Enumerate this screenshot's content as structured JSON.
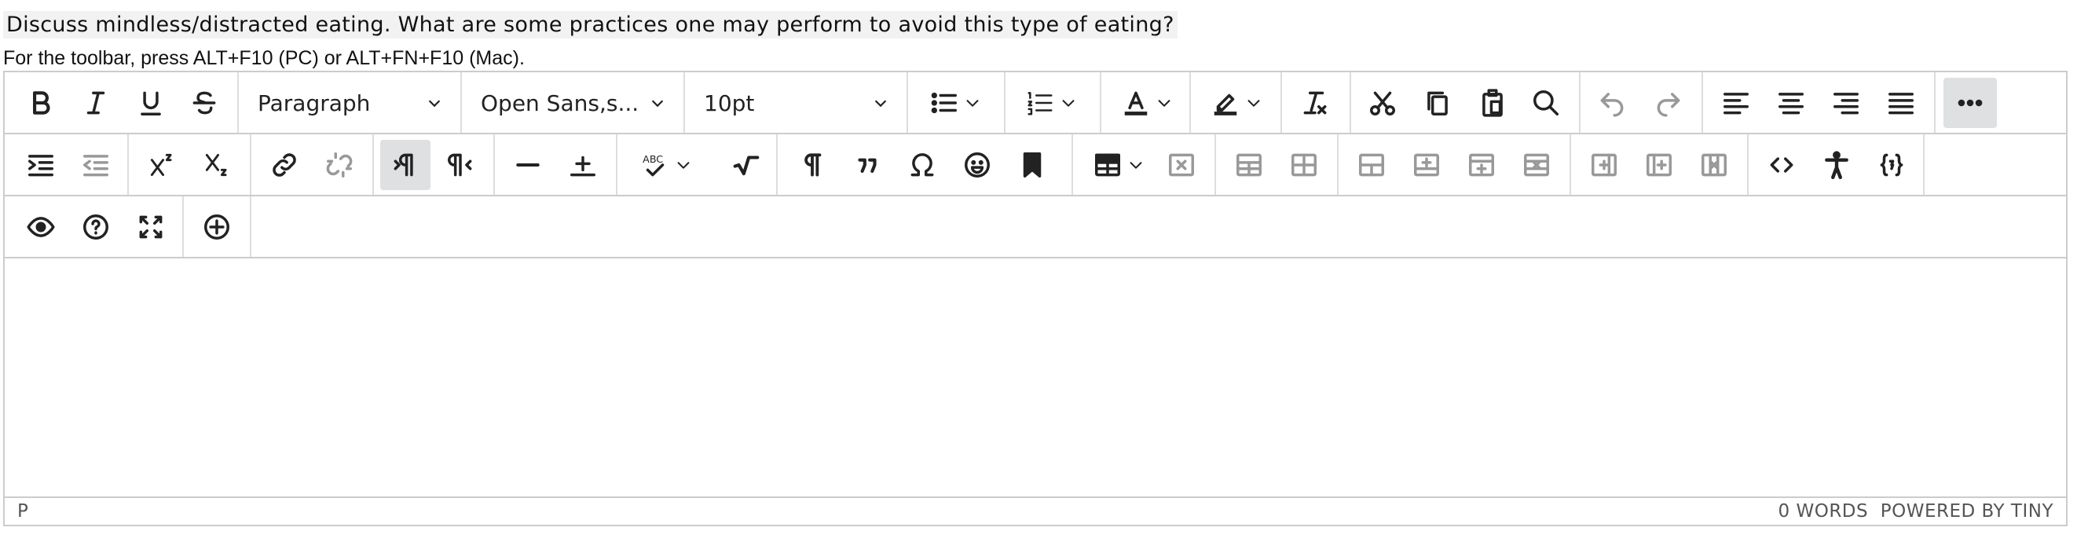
{
  "question": "Discuss mindless/distracted eating.  What are some practices one may perform to avoid this type of eating?",
  "toolbar_hint": "For the toolbar, press ALT+F10 (PC) or ALT+FN+F10 (Mac).",
  "toolbar": {
    "block_format": "Paragraph",
    "font_family": "Open Sans,s...",
    "font_size": "10pt"
  },
  "statusbar": {
    "path": "P",
    "word_count": "0 WORDS",
    "powered_by": "POWERED BY TINY"
  }
}
